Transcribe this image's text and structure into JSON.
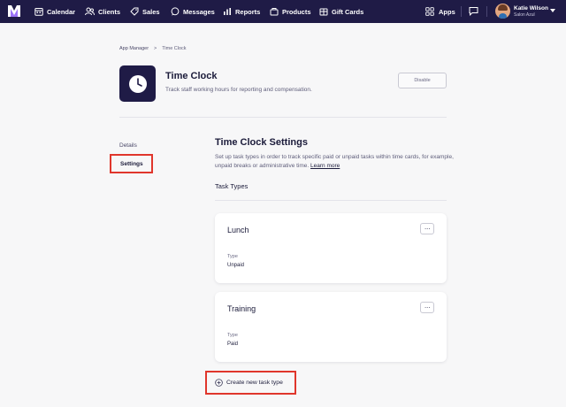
{
  "nav": {
    "items": [
      {
        "label": "Calendar",
        "icon": "calendar-icon"
      },
      {
        "label": "Clients",
        "icon": "clients-icon"
      },
      {
        "label": "Sales",
        "icon": "sales-tag-icon"
      },
      {
        "label": "Messages",
        "icon": "messages-icon"
      },
      {
        "label": "Reports",
        "icon": "reports-icon"
      },
      {
        "label": "Products",
        "icon": "products-icon"
      },
      {
        "label": "Gift Cards",
        "icon": "gift-card-icon"
      }
    ],
    "apps_label": "Apps",
    "user_name": "Katie Wilson",
    "user_salon": "Salon Azul"
  },
  "breadcrumb": {
    "parent": "App Manager",
    "separator": ">",
    "current": "Time Clock"
  },
  "header": {
    "title": "Time Clock",
    "subtitle": "Track staff working hours for reporting and compensation.",
    "disable_label": "Disable"
  },
  "sidebar": {
    "items": [
      {
        "label": "Details"
      },
      {
        "label": "Settings"
      }
    ]
  },
  "settings": {
    "title": "Time Clock Settings",
    "description": "Set up task types in order to track specific paid or unpaid tasks within time cards, for example, unpaid breaks or administrative time.",
    "learn_more": "Learn more",
    "task_types_label": "Task Types",
    "tasks": [
      {
        "name": "Lunch",
        "type_label": "Type",
        "type_value": "Unpaid",
        "more": "···"
      },
      {
        "name": "Training",
        "type_label": "Type",
        "type_value": "Paid",
        "more": "···"
      }
    ],
    "create_label": "Create new task type"
  },
  "colors": {
    "nav_bg": "#1f1b46",
    "page_bg": "#f7f7f8",
    "highlight": "#e0362c"
  }
}
